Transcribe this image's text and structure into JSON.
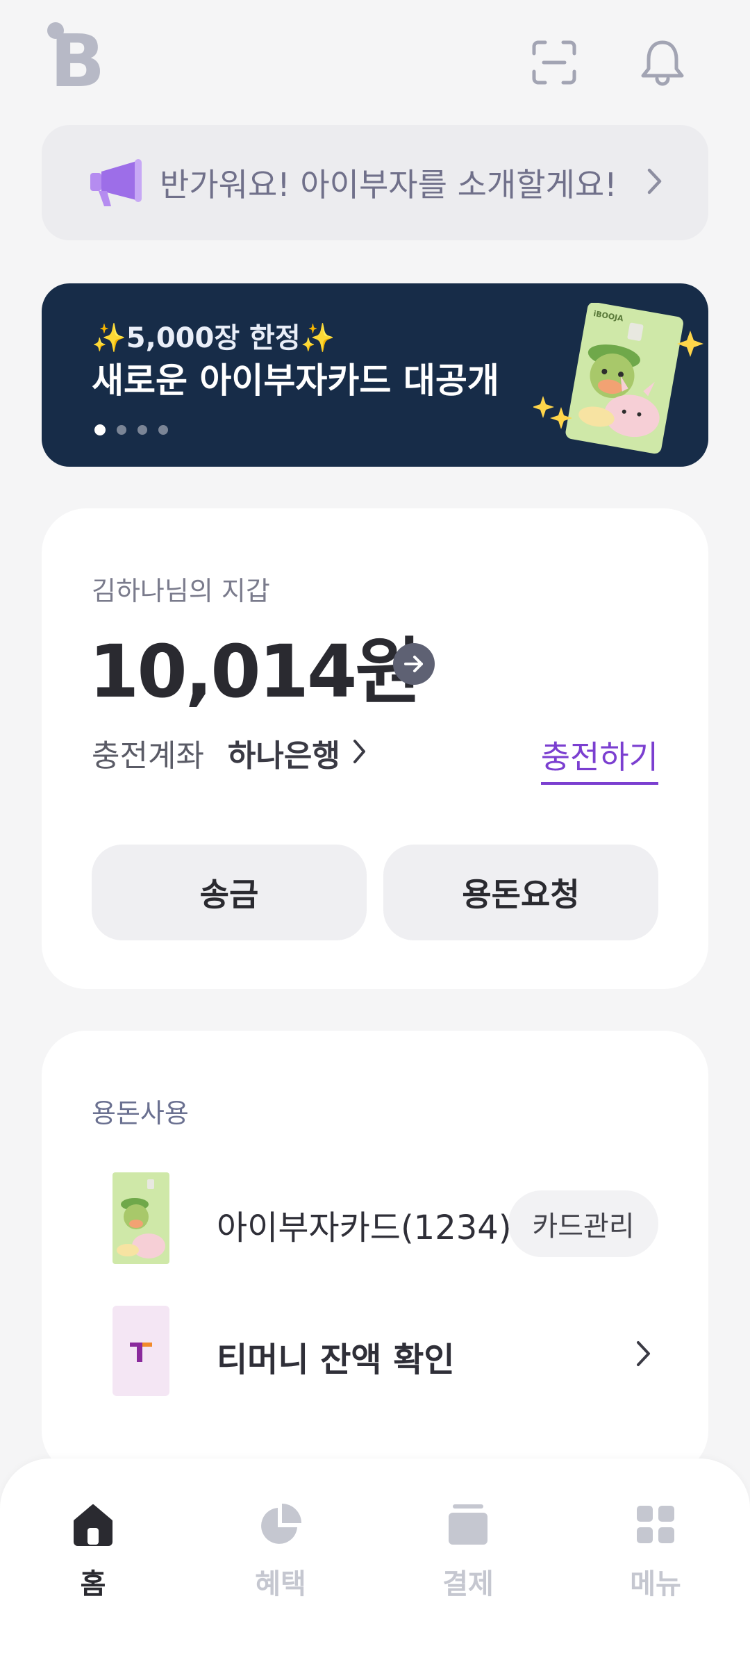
{
  "header": {
    "logo_letter": "B",
    "icons": [
      "scan-icon",
      "bell-icon"
    ]
  },
  "intro_banner": {
    "text": "반가워요! 아이부자를 소개할게요!",
    "icon": "megaphone-icon"
  },
  "promo_banner": {
    "subtitle": "✨5,000장 한정✨",
    "title": "새로운 아이부자카드 대공개",
    "page_index": 1,
    "page_count": 4,
    "card_brand": "iBOOJA"
  },
  "wallet": {
    "label": "김하나님의 지갑",
    "amount": "10,014원",
    "account_label": "충전계좌",
    "bank": "하나은행",
    "charge_link": "충전하기",
    "buttons": {
      "send": "송금",
      "request": "용돈요청"
    }
  },
  "usage": {
    "label": "용돈사용",
    "card_name": "아이부자카드(1234)",
    "card_manage": "카드관리",
    "tmoney": "티머니 잔액 확인"
  },
  "nav": {
    "items": [
      {
        "label": "홈",
        "icon": "home-icon",
        "active": true
      },
      {
        "label": "혜택",
        "icon": "pie-chart-icon",
        "active": false
      },
      {
        "label": "결제",
        "icon": "card-stack-icon",
        "active": false
      },
      {
        "label": "메뉴",
        "icon": "grid-icon",
        "active": false
      }
    ]
  },
  "colors": {
    "background": "#f5f5f6",
    "promo_bg": "#172c48",
    "accent_purple": "#7b3fd0",
    "nav_active": "#2a2a30",
    "nav_inactive": "#c5c7d0"
  }
}
